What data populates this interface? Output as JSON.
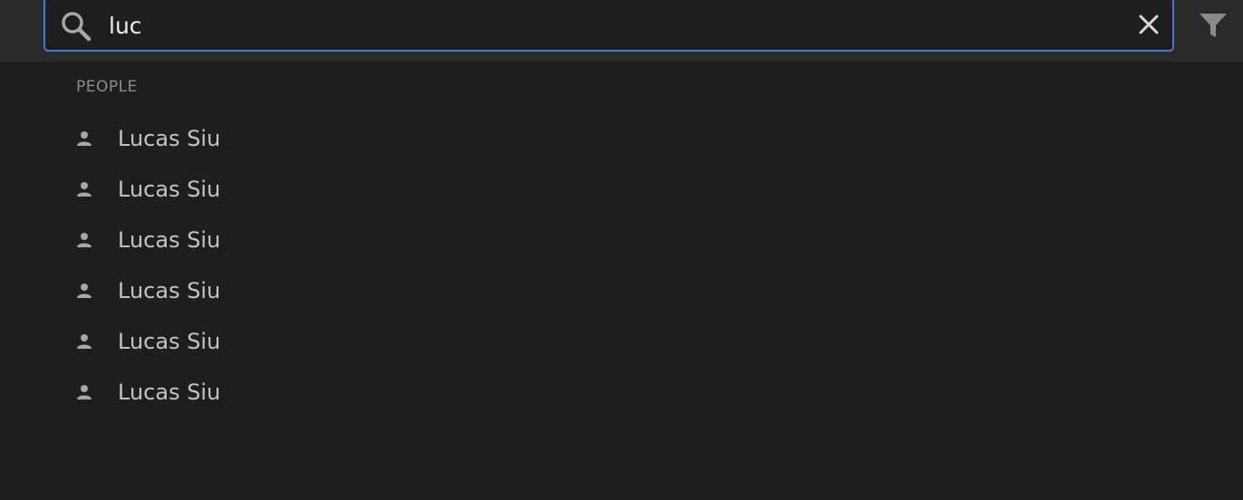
{
  "search": {
    "value": "luc",
    "clear_icon": "close-icon",
    "search_icon": "search-icon",
    "filter_icon": "filter-icon"
  },
  "results": {
    "section_label": "PEOPLE",
    "items": [
      {
        "name": "Lucas Siu",
        "icon": "person-icon"
      },
      {
        "name": "Lucas Siu",
        "icon": "person-icon"
      },
      {
        "name": "Lucas Siu",
        "icon": "person-icon"
      },
      {
        "name": "Lucas Siu",
        "icon": "person-icon"
      },
      {
        "name": "Lucas Siu",
        "icon": "person-icon"
      },
      {
        "name": "Lucas Siu",
        "icon": "person-icon"
      }
    ]
  },
  "colors": {
    "background": "#1e1e1e",
    "topbar": "#2a2a2a",
    "focus_border": "#3b7bd6",
    "text": "#c4c4c4",
    "label": "#8d8d8d"
  }
}
